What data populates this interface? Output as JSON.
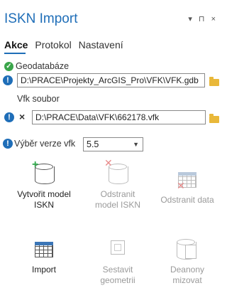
{
  "header": {
    "title": "ISKN Import",
    "tools": "▾ ⊓ ×"
  },
  "tabs": [
    {
      "label": "Akce",
      "active": true
    },
    {
      "label": "Protokol",
      "active": false
    },
    {
      "label": "Nastavení",
      "active": false
    }
  ],
  "geodatabase": {
    "label": "Geodatabáze",
    "value": "D:\\PRACE\\Projekty_ArcGIS_Pro\\VFK\\VFK.gdb"
  },
  "vfk": {
    "label": "Vfk soubor",
    "value": "D:\\PRACE\\Data\\VFK\\662178.vfk"
  },
  "version": {
    "label": "Výběr verze vfk",
    "value": "5.5"
  },
  "actions": [
    {
      "label": "Vytvořit model ISKN",
      "enabled": true
    },
    {
      "label": "Odstranit model ISKN",
      "enabled": false
    },
    {
      "label": "Odstranit data",
      "enabled": false
    },
    {
      "label": "Import",
      "enabled": true
    },
    {
      "label": "Sestavit geometrii",
      "enabled": false
    },
    {
      "label": "Deanony mizovat",
      "enabled": false
    }
  ],
  "colors": {
    "accent": "#1f6eb8",
    "ok": "#3aa54a",
    "folder": "#e9b83a"
  }
}
